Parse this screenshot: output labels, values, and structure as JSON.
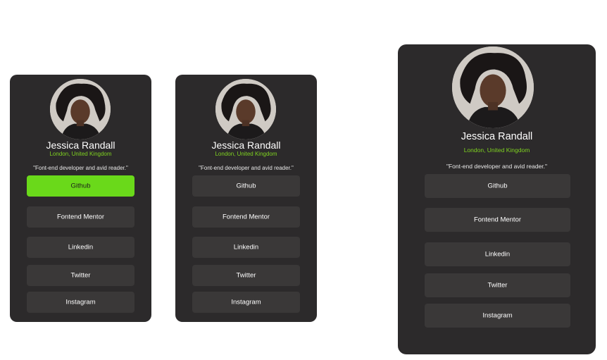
{
  "profile": {
    "name": "Jessica Randall",
    "location": "London, United Kingdom",
    "bio": "\"Font-end developer and avid reader.\""
  },
  "links": [
    {
      "label": "Github"
    },
    {
      "label": "Fontend Mentor"
    },
    {
      "label": "Linkedin"
    },
    {
      "label": "Twitter"
    },
    {
      "label": "Instagram"
    }
  ],
  "colors": {
    "card_bg": "#2c2a2b",
    "button_bg": "#3a3838",
    "accent_green": "#6ad91a",
    "location_green": "#7fd320",
    "text": "#ffffff"
  },
  "states": {
    "card1_active_link": "Github",
    "card2_active_link": "",
    "card3_active_link": ""
  }
}
